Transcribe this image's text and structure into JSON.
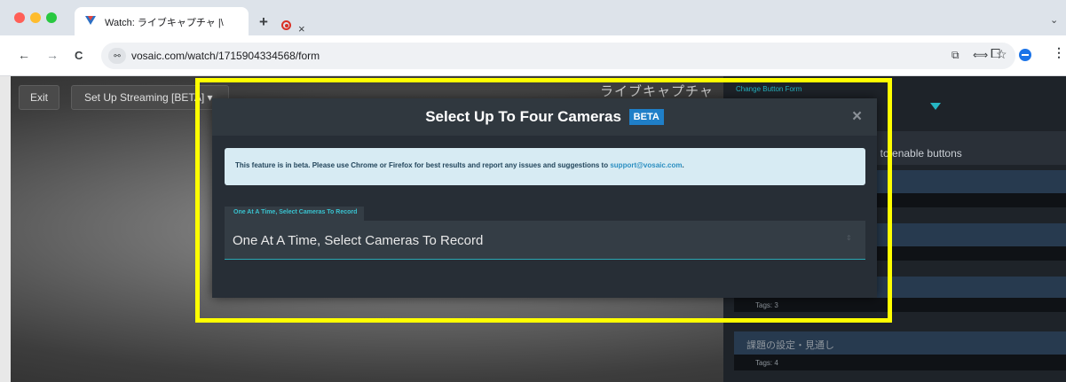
{
  "browser": {
    "tab_title": "Watch: ライブキャプチャ |\\",
    "tab_close": "×",
    "new_tab": "+",
    "tab_list": "⌄",
    "url": "vosaic.com/watch/1715904334568/form",
    "nav": {
      "back": "←",
      "forward": "→",
      "reload": "C"
    },
    "site_info": "⚯",
    "omni_icons": {
      "cast": "⧉",
      "translate": "⟺",
      "bookmark": "☆"
    },
    "extensions_icon": "⧠",
    "menu": "⋮"
  },
  "page": {
    "exit_label": "Exit",
    "setup_label": "Set Up Streaming [BETA] ▾",
    "title_jp": "ライブキャプチャ"
  },
  "right_panel": {
    "form_label": "Change Button Form",
    "hint": "ng to enable buttons",
    "rows": [
      {
        "title": "",
        "tags": ""
      },
      {
        "title": "",
        "tags": ""
      },
      {
        "title": "",
        "tags": "Tags: 3"
      },
      {
        "title": "課題の設定・見通し",
        "tags": "Tags: 4"
      }
    ]
  },
  "modal": {
    "title": "Select Up To Four Cameras",
    "beta": "BETA",
    "close": "×",
    "info_text": "This feature is in beta. Please use Chrome or Firefox for best results and report any issues and suggestions to",
    "info_email": "support@vosaic.com",
    "info_end": ".",
    "field_label": "One At A Time, Select Cameras To Record",
    "field_value": "One At A Time, Select Cameras To Record",
    "field_arrows": "⇕"
  },
  "colors": {
    "highlight": "#ffff00",
    "accent_teal": "#39c3d0",
    "beta_blue": "#1f7fc8",
    "info_bg": "#d7ebf3"
  }
}
